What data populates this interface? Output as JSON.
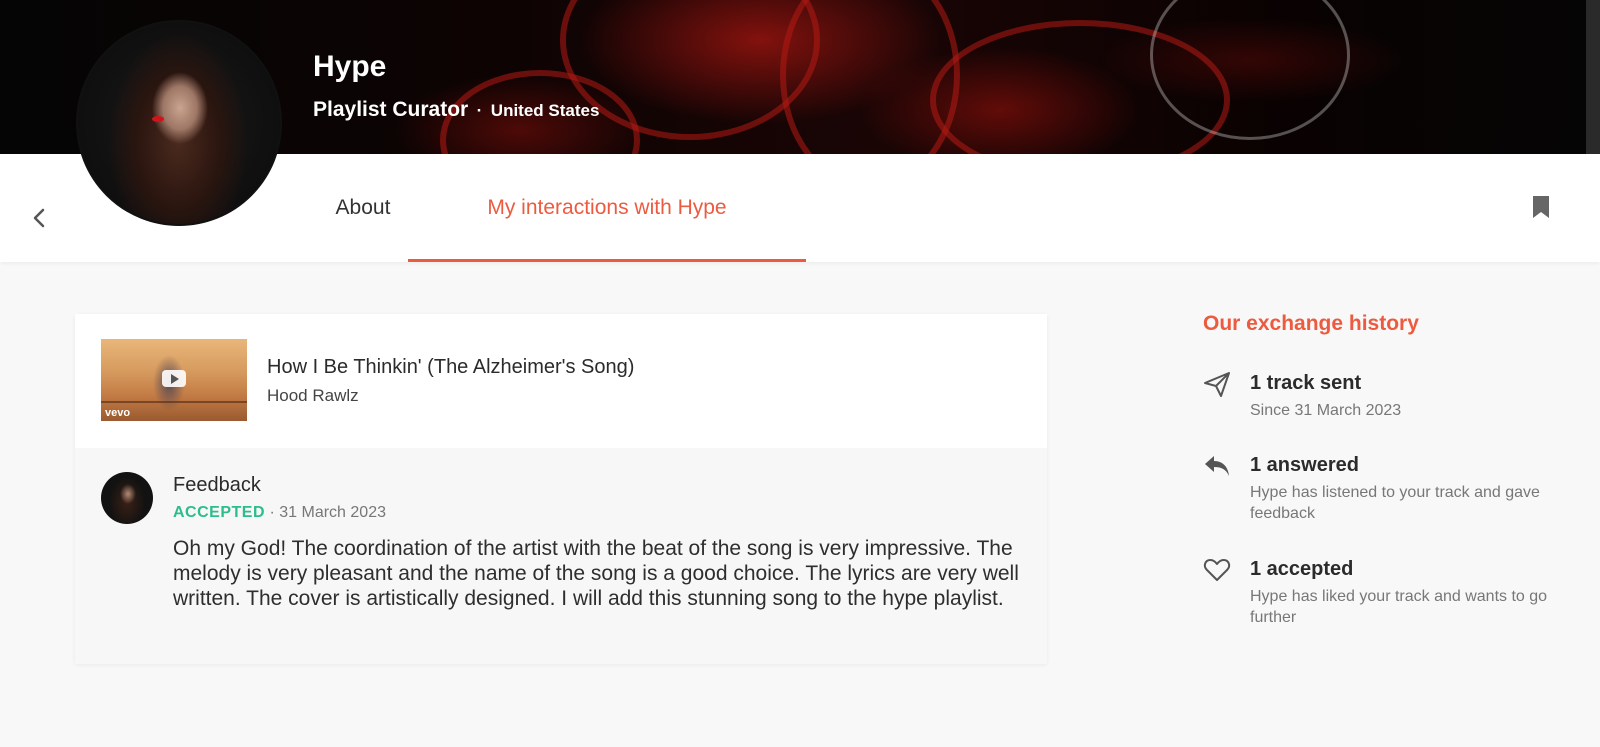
{
  "profile": {
    "name": "Hype",
    "role": "Playlist Curator",
    "separator": "·",
    "country": "United States"
  },
  "tabs": [
    {
      "label": "About",
      "active": false
    },
    {
      "label": "My interactions with Hype",
      "active": true
    }
  ],
  "track": {
    "title": "How I Be Thinkin' (The Alzheimer's Song)",
    "artist": "Hood Rawlz",
    "thumbnail_badge": "vevo"
  },
  "feedback": {
    "title": "Feedback",
    "status": "ACCEPTED",
    "separator": "·",
    "date": "31 March 2023",
    "body": "Oh my God! The coordination of the artist with the beat of the song is very impressive. The melody is very pleasant and the name of the song is a good choice. The lyrics are very well written. The cover is artistically designed. I will add this stunning song to the hype playlist."
  },
  "history": {
    "title": "Our exchange history",
    "items": [
      {
        "icon": "paper-plane-icon",
        "label": "1 track sent",
        "description": "Since 31 March 2023"
      },
      {
        "icon": "reply-icon",
        "label": "1 answered",
        "description": "Hype has listened to your track and gave feedback"
      },
      {
        "icon": "heart-icon",
        "label": "1 accepted",
        "description": "Hype has liked your track and wants to go further"
      }
    ]
  },
  "colors": {
    "accent": "#ec5b40",
    "accepted": "#2dbd8a",
    "text": "#2b2b2b",
    "muted": "#777777"
  }
}
